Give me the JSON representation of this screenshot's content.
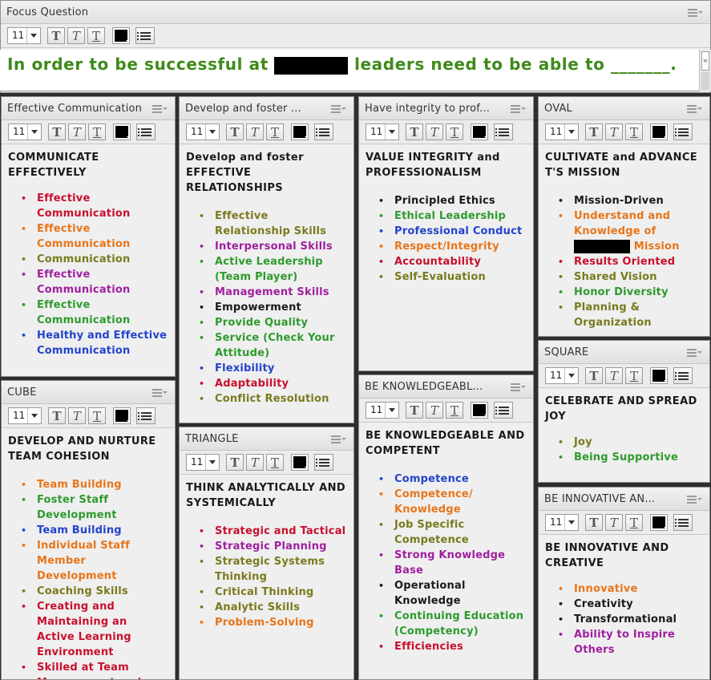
{
  "font_size_value": "11",
  "toolbar_glyph": "T",
  "colors": {
    "black": "#1a1a1a",
    "red": "#c8102e",
    "orange": "#e8751a",
    "olive": "#7a7a1e",
    "purple": "#a020a0",
    "green": "#2e9b2e",
    "blue": "#2244cc"
  },
  "focus": {
    "title": "Focus Question",
    "text_before": "In order to be successful at",
    "text_after": "leaders need to be able to _______."
  },
  "pods": {
    "effective_communication": {
      "title": "Effective Communication",
      "heading": "COMMUNICATE EFFECTIVELY",
      "items": [
        {
          "label": "Effective Communication",
          "color": "red"
        },
        {
          "label": "Effective Communication",
          "color": "orange"
        },
        {
          "label": "Communication",
          "color": "olive"
        },
        {
          "label": "Effective Communication",
          "color": "purple"
        },
        {
          "label": "Effective Communication",
          "color": "green"
        },
        {
          "label": "Healthy and Effective Communication",
          "color": "blue"
        }
      ]
    },
    "develop_foster": {
      "title": "Develop and foster ...",
      "heading": "Develop and foster EFFECTIVE RELATIONSHIPS",
      "items": [
        {
          "label": "Effective Relationship Skills",
          "color": "olive"
        },
        {
          "label": "Interpersonal Skills",
          "color": "purple"
        },
        {
          "label": "Active Leadership (Team Player)",
          "color": "green"
        },
        {
          "label": "Management Skills",
          "color": "purple"
        },
        {
          "label": "Empowerment",
          "color": "black"
        },
        {
          "label": "Provide Quality",
          "color": "green"
        },
        {
          "label": "Service (Check Your Attitude)",
          "color": "green"
        },
        {
          "label": "Flexibility",
          "color": "blue"
        },
        {
          "label": "Adaptability",
          "color": "red"
        },
        {
          "label": "Conflict Resolution",
          "color": "olive"
        }
      ]
    },
    "integrity": {
      "title": "Have integrity to prof...",
      "heading": "VALUE INTEGRITY and PROFESSIONALISM",
      "items": [
        {
          "label": "Principled Ethics",
          "color": "black"
        },
        {
          "label": "Ethical Leadership",
          "color": "green"
        },
        {
          "label": "Professional Conduct",
          "color": "blue"
        },
        {
          "label": "Respect/Integrity",
          "color": "orange"
        },
        {
          "label": "Accountability",
          "color": "red"
        },
        {
          "label": "Self-Evaluation",
          "color": "olive"
        }
      ]
    },
    "oval": {
      "title": "OVAL",
      "heading": "CULTIVATE and ADVANCE T'S MISSION",
      "items": [
        {
          "label": "Mission-Driven",
          "color": "black"
        },
        {
          "label": "Understand and Knowledge of",
          "label_after": "Mission",
          "color": "orange",
          "redact": true
        },
        {
          "label": "Results Oriented",
          "color": "red"
        },
        {
          "label": "Shared Vision",
          "color": "olive"
        },
        {
          "label": "Honor Diversity",
          "color": "green"
        },
        {
          "label": "Planning & Organization",
          "color": "olive"
        }
      ]
    },
    "square": {
      "title": "SQUARE",
      "heading": "CELEBRATE AND SPREAD JOY",
      "items": [
        {
          "label": "Joy",
          "color": "olive"
        },
        {
          "label": "Being Supportive",
          "color": "green"
        }
      ]
    },
    "cube": {
      "title": "CUBE",
      "heading": "DEVELOP AND NURTURE TEAM COHESION",
      "items": [
        {
          "label": "Team Building",
          "color": "orange"
        },
        {
          "label": "Foster Staff Development",
          "color": "green"
        },
        {
          "label": "Team Building",
          "color": "blue"
        },
        {
          "label": "Individual Staff Member Development",
          "color": "orange"
        },
        {
          "label": "Coaching Skills",
          "color": "olive"
        },
        {
          "label": "Creating and Maintaining an Active Learning Environment",
          "color": "red"
        },
        {
          "label": "Skilled at Team Management and Development",
          "color": "red"
        }
      ]
    },
    "triangle": {
      "title": "TRIANGLE",
      "heading": "THINK ANALYTICALLY AND SYSTEMICALLY",
      "items": [
        {
          "label": "Strategic and Tactical",
          "color": "red"
        },
        {
          "label": "Strategic Planning",
          "color": "purple"
        },
        {
          "label": "Strategic Systems Thinking",
          "color": "olive"
        },
        {
          "label": "Critical Thinking",
          "color": "olive"
        },
        {
          "label": "Analytic Skills",
          "color": "olive"
        },
        {
          "label": "Problem-Solving",
          "color": "orange"
        }
      ]
    },
    "knowledgeable": {
      "title": "BE KNOWLEDGEABL...",
      "heading": "BE KNOWLEDGEABLE AND COMPETENT",
      "items": [
        {
          "label": "Competence",
          "color": "blue"
        },
        {
          "label": "Competence/ Knowledge",
          "color": "orange"
        },
        {
          "label": "Job Specific Competence",
          "color": "olive"
        },
        {
          "label": "Strong Knowledge Base",
          "color": "purple"
        },
        {
          "label": "Operational Knowledge",
          "color": "black"
        },
        {
          "label": "Continuing Education (Competency)",
          "color": "green"
        },
        {
          "label": "Efficiencies",
          "color": "red"
        }
      ]
    },
    "innovative": {
      "title": "BE INNOVATIVE AN...",
      "heading": "BE INNOVATIVE AND CREATIVE",
      "items": [
        {
          "label": "Innovative",
          "color": "orange"
        },
        {
          "label": "Creativity",
          "color": "black"
        },
        {
          "label": "Transformational",
          "color": "black"
        },
        {
          "label": "Ability to Inspire Others",
          "color": "purple"
        }
      ]
    }
  }
}
